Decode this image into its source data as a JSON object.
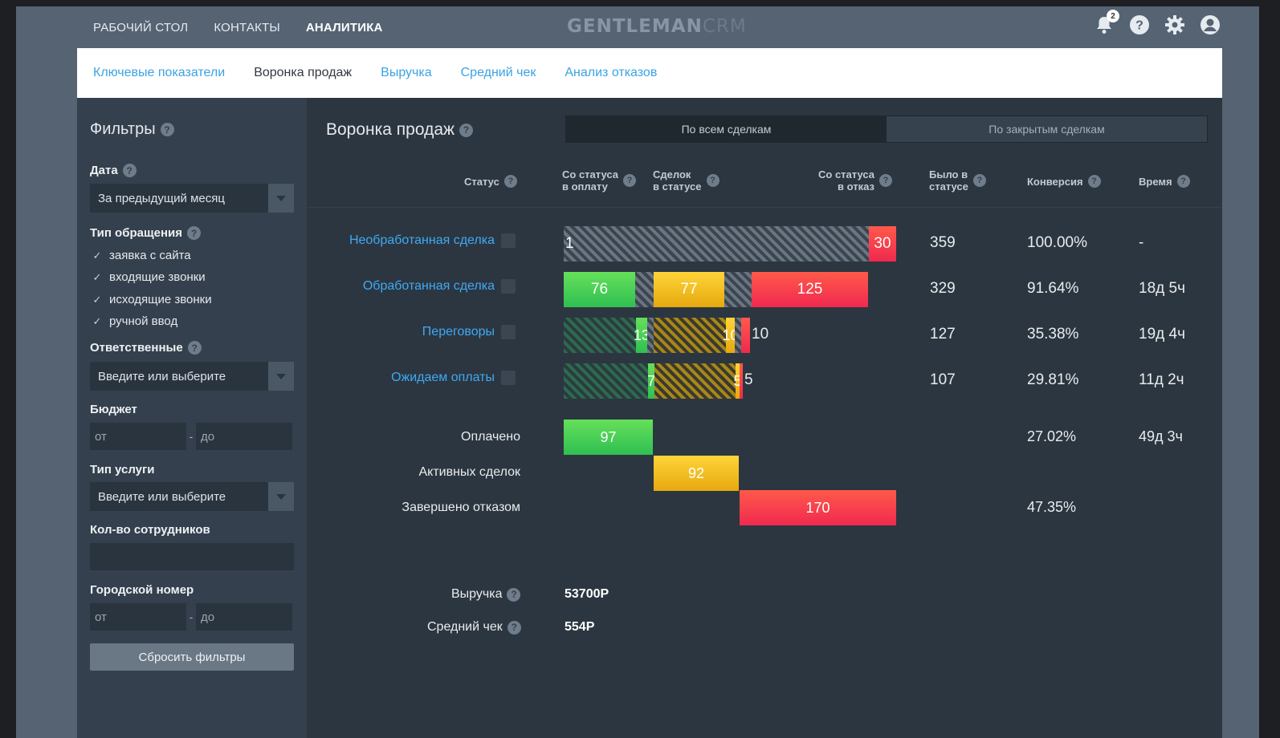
{
  "topnav": {
    "items": [
      "РАБОЧИЙ СТОЛ",
      "КОНТАКТЫ",
      "АНАЛИТИКА"
    ],
    "active_index": 2,
    "brand_bold": "GENTLEMAN",
    "brand_light": "CRM",
    "notification_count": "2",
    "icons": [
      "bell-icon",
      "help-icon",
      "gear-icon",
      "user-icon"
    ]
  },
  "subtabs": [
    "Ключевые показатели",
    "Воронка продаж",
    "Выручка",
    "Средний чек",
    "Анализ отказов"
  ],
  "filters": {
    "title": "Фильтры",
    "date_label": "Дата",
    "date_value": "За предыдущий месяц",
    "type_label": "Тип обращения",
    "type_options": [
      "заявка с сайта",
      "входящие звонки",
      "исходящие звонки",
      "ручной ввод"
    ],
    "responsible_label": "Ответственные",
    "responsible_placeholder": "Введите или выберите",
    "budget_label": "Бюджет",
    "from": "от",
    "to": "до",
    "service_label": "Тип услуги",
    "service_placeholder": "Введите или выберите",
    "employees_label": "Кол-во сотрудников",
    "city_label": "Городской номер",
    "reset": "Сбросить фильтры"
  },
  "funnel": {
    "title": "Воронка продаж",
    "toggle": [
      "По всем сделкам",
      "По закрытым сделкам"
    ],
    "headers": {
      "status": "Статус",
      "to_paid": [
        "Со статуса",
        "в оплату"
      ],
      "in_status": [
        "Сделок",
        "в статусе"
      ],
      "to_reject": [
        "Со статуса",
        "в отказ"
      ],
      "was_in": [
        "Было в",
        "статусе"
      ],
      "conversion": "Конверсия",
      "time": "Время"
    },
    "rows": [
      {
        "name": "Необработанная сделка",
        "paid": "1",
        "reject": "30",
        "total": "359",
        "conv": "100.00%",
        "time": "-"
      },
      {
        "name": "Обработанная сделка",
        "paid": "76",
        "active": "77",
        "reject": "125",
        "total": "329",
        "conv": "91.64%",
        "time": "18д 5ч"
      },
      {
        "name": "Переговоры",
        "paid": "13",
        "active": "10",
        "reject": "10",
        "total": "127",
        "conv": "35.38%",
        "time": "19д 4ч"
      },
      {
        "name": "Ожидаем оплаты",
        "paid": "7",
        "active": "5",
        "reject": "5",
        "total": "107",
        "conv": "29.81%",
        "time": "11д 2ч"
      }
    ],
    "summary": [
      {
        "name": "Оплачено",
        "value": "97",
        "conv": "27.02%",
        "time": "49д 3ч"
      },
      {
        "name": "Активных сделок",
        "value": "92"
      },
      {
        "name": "Завершено отказом",
        "value": "170",
        "conv": "47.35%"
      }
    ],
    "revenue_label": "Выручка",
    "revenue_value": "53700Р",
    "avg_label": "Средний чек",
    "avg_value": "554Р"
  },
  "colors": {
    "green": "#2fbf52",
    "yellow": "#e6a90e",
    "red": "#f0294f",
    "link": "#3fa9f5"
  }
}
